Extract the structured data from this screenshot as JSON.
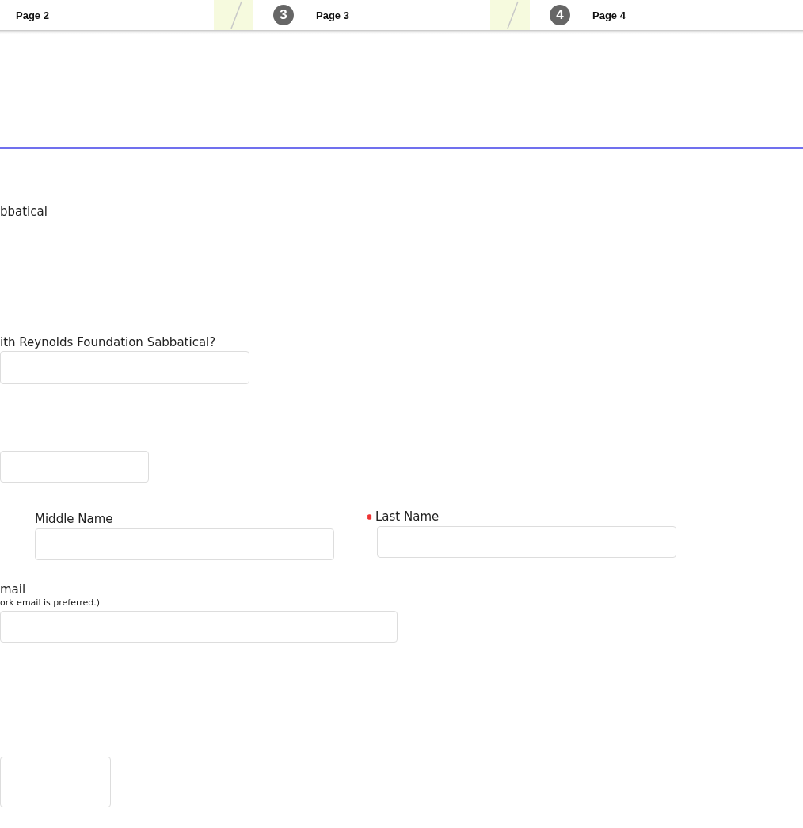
{
  "steps": [
    {
      "label": "Page 2"
    },
    {
      "number": "3",
      "label": "Page 3"
    },
    {
      "number": "4",
      "label": "Page 4"
    }
  ],
  "form": [
    {
      "kind": "heading",
      "text": "bbatical"
    },
    {
      "kind": "question",
      "label": "ith Reynolds Foundation Sabbatical?",
      "required": false
    },
    {
      "kind": "field"
    },
    {
      "kind": "names",
      "fields": [
        {
          "label": "Middle Name",
          "required": false
        },
        {
          "label": "Last Name",
          "required": true
        }
      ]
    },
    {
      "kind": "email",
      "label": "mail",
      "hint": "ork email is preferred.)"
    },
    {
      "kind": "textarea"
    }
  ]
}
